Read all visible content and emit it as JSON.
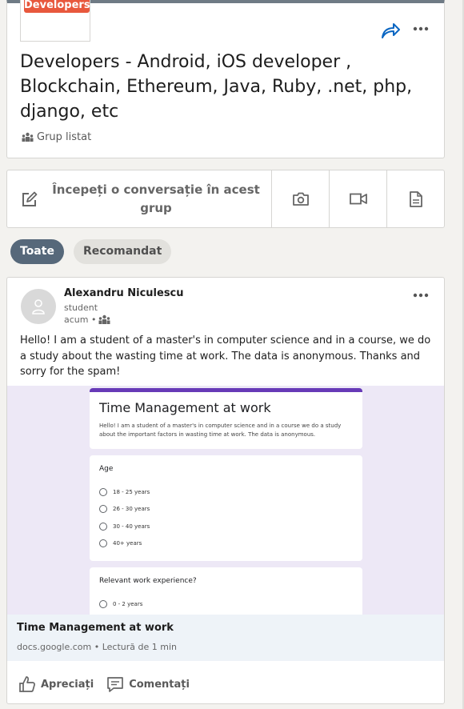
{
  "group": {
    "logo_text": "Developers",
    "title": "Developers - Android, iOS developer , Blockchain, Ethereum, Java, Ruby, .net, php, django, etc",
    "status": "Grup listat"
  },
  "composer": {
    "prompt": "Începeți o conversație în acest grup"
  },
  "filters": {
    "all": "Toate",
    "recommended": "Recomandat"
  },
  "post": {
    "author": "Alexandru Niculescu",
    "headline": "student",
    "time": "acum •",
    "text": "Hello! I am a student of a master's in computer science and in a course, we do a study about the wasting time at work. The data is anonymous. Thanks and sorry for the spam!",
    "preview": {
      "form_title": "Time Management at work",
      "form_desc": "Hello! I am a student of a master's in computer science and in a course we do a study about the important factors in wasting time at work. The data is anonymous.",
      "q1_label": "Age",
      "q1_options": [
        "18 - 25 years",
        "26 - 30 years",
        "30 - 40 years",
        "40+ years"
      ],
      "q2_label": "Relevant work experience?",
      "q2_options": [
        "0 - 2 years"
      ]
    },
    "link_title": "Time Management at work",
    "link_source": "docs.google.com • Lectură de 1 min",
    "like_label": "Apreciați",
    "comment_label": "Comentați"
  },
  "colors": {
    "accent": "#0a66c2",
    "logo_badge": "#e8583d",
    "pill_active": "#56687a",
    "form_accent": "#673ab7"
  }
}
